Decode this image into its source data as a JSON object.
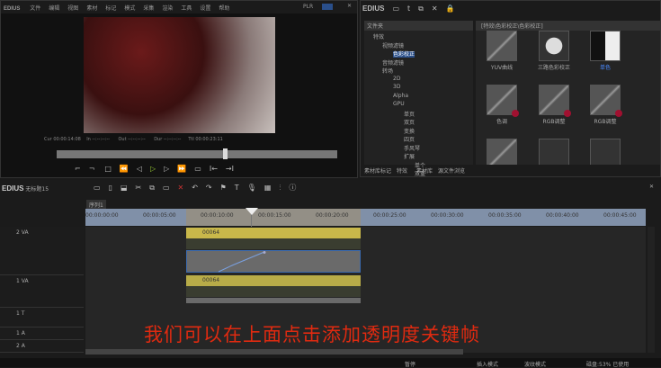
{
  "player": {
    "app": "EDIUS",
    "menu": [
      "文件",
      "编辑",
      "视图",
      "素材",
      "标记",
      "模式",
      "采集",
      "渲染",
      "工具",
      "设置",
      "帮助"
    ],
    "mode": "PLR",
    "mode_active": "REC",
    "timecodes": {
      "cur_label": "Cur",
      "cur": "00:00:14:08",
      "in_label": "In",
      "in": "--:--:--:--",
      "out_label": "Out",
      "out": "--:--:--:--",
      "dur_label": "Dur",
      "dur": "--:--:--:--",
      "ttl_label": "Ttl",
      "ttl": "00:00:23:11"
    }
  },
  "effects": {
    "app": "EDIUS",
    "tree_title": "文件夹",
    "path": "[特效\\色彩校正\\色彩校正]",
    "tree": [
      "特效",
      "视频滤镜",
      "色彩校正",
      "音频滤镜",
      "转场",
      "2D",
      "3D",
      "Alpha",
      "GPU",
      "单页",
      "双页",
      "变换",
      "四页",
      "手风琴",
      "扩展",
      "单个",
      "双重"
    ],
    "items": [
      {
        "label": "YUV曲线"
      },
      {
        "label": "三路色彩校正"
      },
      {
        "label": "单色"
      },
      {
        "label": "色调"
      },
      {
        "label": "RGB调整"
      },
      {
        "label": "RGB调整"
      },
      {
        "label": ""
      },
      {
        "label": ""
      },
      {
        "label": ""
      }
    ],
    "tabs": [
      "素材库标记",
      "特效",
      "素材库",
      "源文件浏览"
    ]
  },
  "timeline": {
    "app": "EDIUS",
    "project": "无标题15",
    "sequence": "序列1",
    "ruler": [
      "00:00:00:00",
      "00:00:05:00",
      "00:00:10:00",
      "00:00:15:00",
      "00:00:20:00",
      "00:00:25:00",
      "00:00:30:00",
      "00:00:35:00",
      "00:00:40:00",
      "00:00:45:00"
    ],
    "tracks": [
      {
        "name": "2 VA"
      },
      {
        "name": "1 VA"
      },
      {
        "name": "1 T"
      },
      {
        "name": "1 A"
      },
      {
        "name": "2 A"
      }
    ],
    "clips": [
      {
        "name": "00064"
      },
      {
        "name": "00064"
      }
    ],
    "subtitle": "我们可以在上面点击添加透明度关键帧",
    "status": [
      "暂停",
      "插入模式",
      "波纹模式",
      "磁盘:53% 已使用"
    ]
  },
  "colors": {
    "clip": "#c9b84a",
    "subtitle": "#e02a10",
    "accent": "#2a4f8a"
  }
}
